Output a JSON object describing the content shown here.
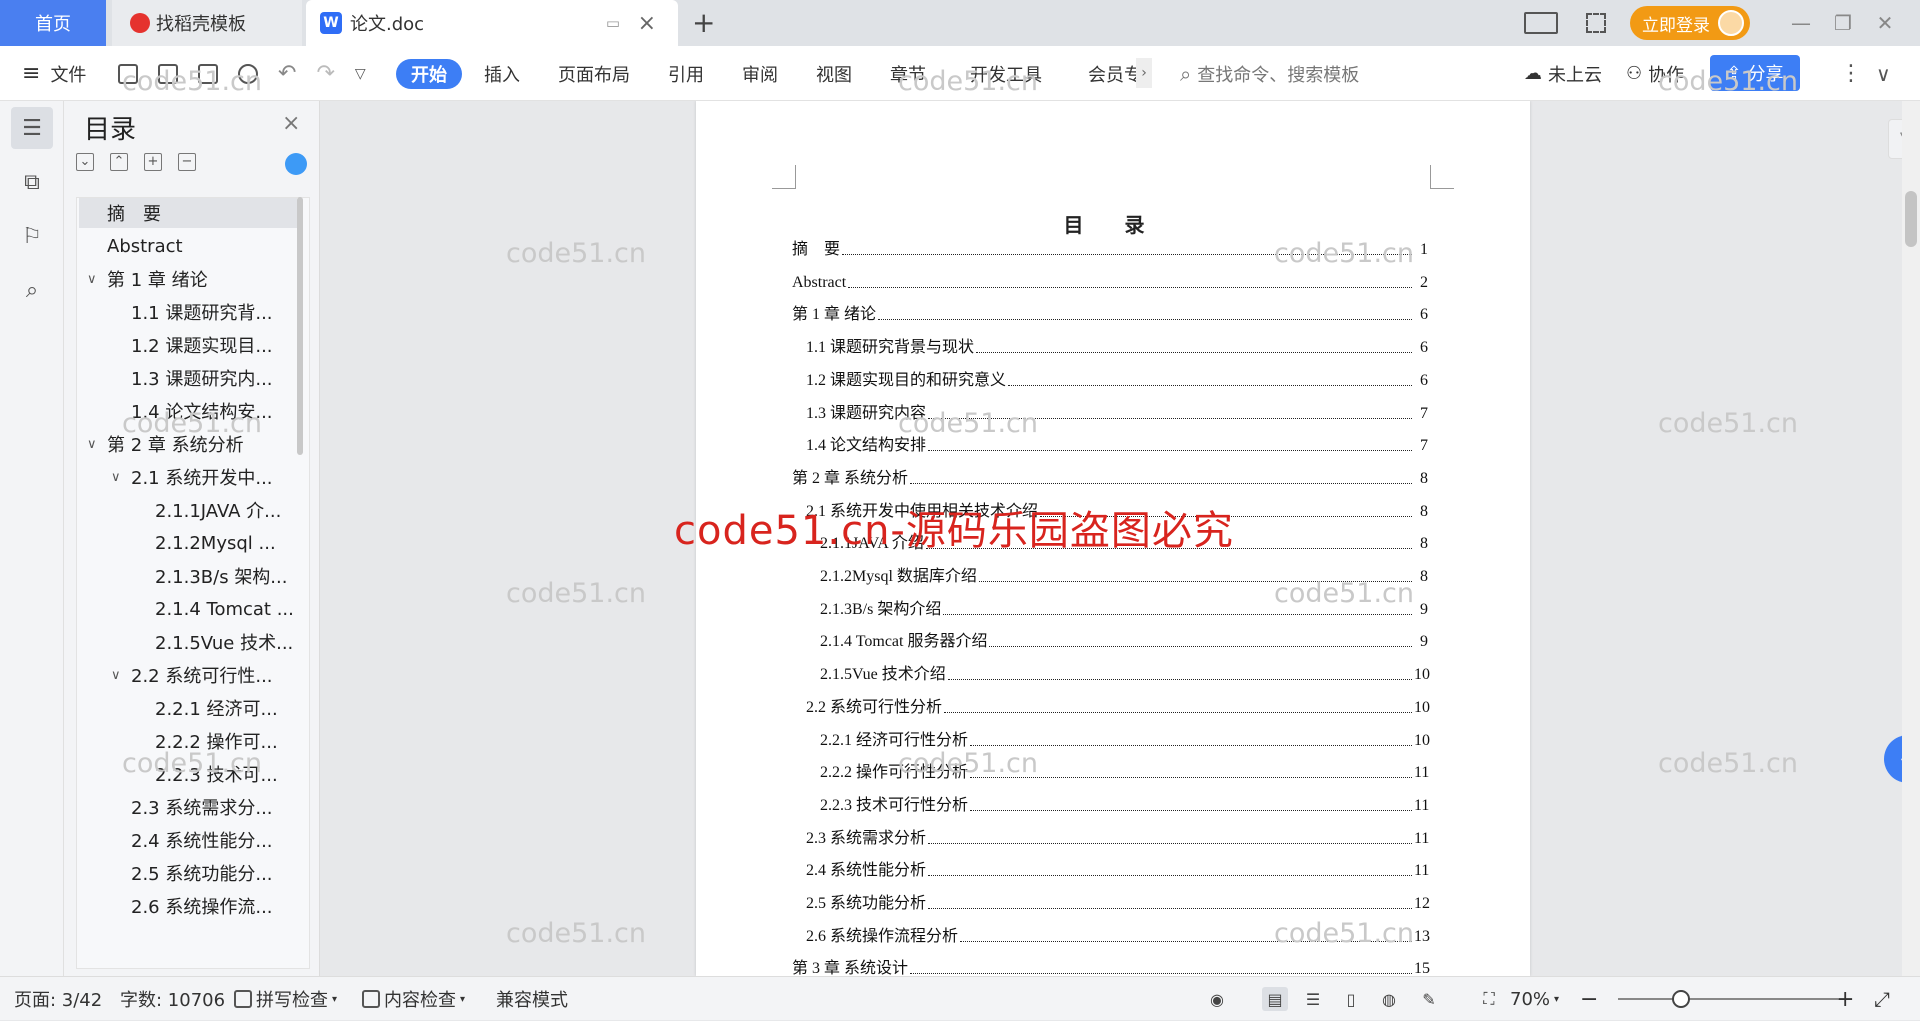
{
  "tabs": {
    "home": "首页",
    "docer": "找稻壳模板",
    "document": "论文.doc",
    "new_tab_icon": "plus-icon"
  },
  "titlebar": {
    "login": "立即登录",
    "layout_icon": "layout-icon",
    "grid_icon": "apps-grid-icon"
  },
  "menu": {
    "file": "文件",
    "items": [
      "开始",
      "插入",
      "页面布局",
      "引用",
      "审阅",
      "视图",
      "章节",
      "开发工具",
      "会员专"
    ],
    "search_placeholder": "查找命令、搜索模板",
    "cloud": "未上云",
    "collab": "协作",
    "share": "分享"
  },
  "nav": {
    "title": "目录",
    "items": [
      {
        "label": "摘　要",
        "level": 1
      },
      {
        "label": "Abstract",
        "level": 1
      },
      {
        "label": "第 1 章  绪论",
        "level": 1,
        "expander": "∨"
      },
      {
        "label": "1.1 课题研究背...",
        "level": 2
      },
      {
        "label": "1.2 课题实现目...",
        "level": 2
      },
      {
        "label": "1.3 课题研究内...",
        "level": 2
      },
      {
        "label": "1.4 论文结构安...",
        "level": 2
      },
      {
        "label": "第 2 章  系统分析",
        "level": 1,
        "expander": "∨"
      },
      {
        "label": "2.1 系统开发中...",
        "level": 2,
        "expander": "∨"
      },
      {
        "label": "2.1.1JAVA 介...",
        "level": 3
      },
      {
        "label": "2.1.2Mysql ...",
        "level": 3
      },
      {
        "label": "2.1.3B/s 架构...",
        "level": 3
      },
      {
        "label": "2.1.4 Tomcat ...",
        "level": 3
      },
      {
        "label": "2.1.5Vue 技术...",
        "level": 3
      },
      {
        "label": "2.2 系统可行性...",
        "level": 2,
        "expander": "∨"
      },
      {
        "label": "2.2.1 经济可...",
        "level": 3
      },
      {
        "label": "2.2.2 操作可...",
        "level": 3
      },
      {
        "label": "2.2.3 技术可...",
        "level": 3
      },
      {
        "label": "2.3 系统需求分...",
        "level": 2
      },
      {
        "label": "2.4 系统性能分...",
        "level": 2
      },
      {
        "label": "2.5 系统功能分...",
        "level": 2
      },
      {
        "label": "2.6 系统操作流...",
        "level": 2
      }
    ]
  },
  "document": {
    "toc_title": "目  录",
    "toc": [
      {
        "text": "摘　要",
        "page": "1",
        "indent": 0
      },
      {
        "text": "Abstract",
        "page": "2",
        "indent": 0
      },
      {
        "text": "第 1 章  绪论",
        "page": "6",
        "indent": 0
      },
      {
        "text": "1.1 课题研究背景与现状",
        "page": "6",
        "indent": 1
      },
      {
        "text": "1.2 课题实现目的和研究意义",
        "page": "6",
        "indent": 1
      },
      {
        "text": "1.3 课题研究内容",
        "page": "7",
        "indent": 1
      },
      {
        "text": "1.4 论文结构安排",
        "page": "7",
        "indent": 1
      },
      {
        "text": "第 2 章  系统分析",
        "page": "8",
        "indent": 0
      },
      {
        "text": "2.1 系统开发中使用相关技术介绍",
        "page": "8",
        "indent": 1
      },
      {
        "text": "2.1.1JAVA 介绍",
        "page": "8",
        "indent": 2
      },
      {
        "text": "2.1.2Mysql 数据库介绍",
        "page": "8",
        "indent": 2
      },
      {
        "text": "2.1.3B/s 架构介绍",
        "page": "9",
        "indent": 2
      },
      {
        "text": "2.1.4 Tomcat 服务器介绍",
        "page": "9",
        "indent": 2
      },
      {
        "text": "2.1.5Vue 技术介绍",
        "page": "10",
        "indent": 2
      },
      {
        "text": "2.2 系统可行性分析",
        "page": "10",
        "indent": 1
      },
      {
        "text": "2.2.1 经济可行性分析",
        "page": "10",
        "indent": 2
      },
      {
        "text": "2.2.2 操作可行性分析",
        "page": "11",
        "indent": 2
      },
      {
        "text": "2.2.3 技术可行性分析",
        "page": "11",
        "indent": 2
      },
      {
        "text": "2.3 系统需求分析",
        "page": "11",
        "indent": 1
      },
      {
        "text": "2.4 系统性能分析",
        "page": "11",
        "indent": 1
      },
      {
        "text": "2.5 系统功能分析",
        "page": "12",
        "indent": 1
      },
      {
        "text": "2.6 系统操作流程分析",
        "page": "13",
        "indent": 1
      },
      {
        "text": "第 3 章  系统设计",
        "page": "15",
        "indent": 0
      }
    ]
  },
  "watermarks": {
    "small": "code51.cn",
    "big": "code51.cn-源码乐园盗图必究"
  },
  "status": {
    "page": "页面: 3/42",
    "words": "字数: 10706",
    "spell": "拼写检查",
    "content": "内容检查",
    "compat": "兼容模式",
    "zoom": "70%"
  }
}
